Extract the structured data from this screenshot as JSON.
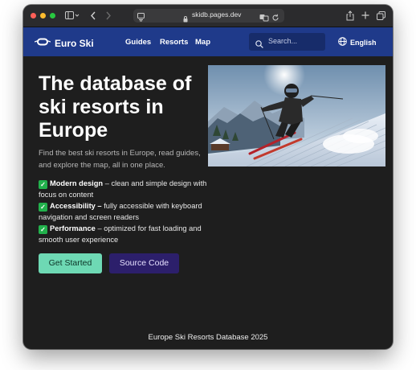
{
  "browser": {
    "url": "skidb.pages.dev",
    "traffic_light_colors": [
      "#ff5f57",
      "#febc2e",
      "#28c840"
    ]
  },
  "site": {
    "logo_text": "Euro Ski",
    "nav": [
      "Guides",
      "Resorts",
      "Map"
    ],
    "search_placeholder": "Search...",
    "language": "English"
  },
  "hero": {
    "title": "The database of ski resorts in Europe",
    "subtitle": "Find the best ski resorts in Europe, read guides, and explore the map, all in one place.",
    "features": [
      {
        "title": "Modern design",
        "text": "– clean and simple design with focus on content"
      },
      {
        "title": "Accessibility –",
        "text": "fully accessible with keyboard navigation and screen readers"
      },
      {
        "title": "Performance",
        "text": "– optimized for fast loading and smooth user experience"
      }
    ],
    "primary_button": "Get Started",
    "secondary_button": "Source Code"
  },
  "footer": {
    "text": "Europe Ski Resorts Database 2025"
  },
  "colors": {
    "header_bg": "#1f3a8a",
    "page_bg": "#1e1e1e",
    "primary_button": "#6ed9b4",
    "secondary_button": "#2c1f6b"
  }
}
